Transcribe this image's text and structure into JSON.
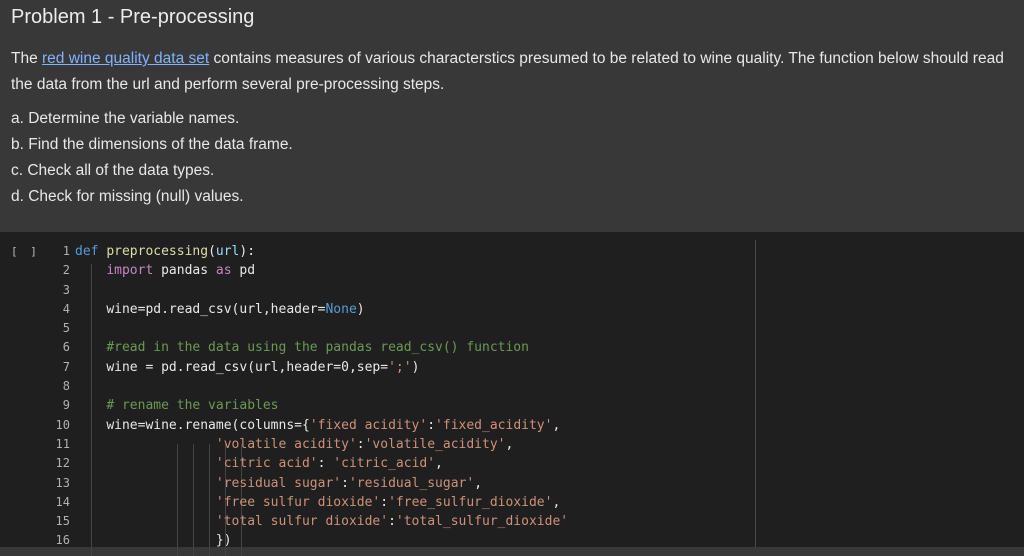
{
  "text_cell": {
    "title": "Problem 1 - Pre-processing",
    "intro_before_link": "The ",
    "link_text": "red wine quality data set",
    "intro_after_link": " contains measures of various characterstics presumed to be related to wine quality. The function below should read the data from the url and perform several pre-processing steps.",
    "steps": [
      "a. Determine the variable names.",
      "b. Find the dimensions of the data frame.",
      "c. Check all of the data types.",
      "d. Check for missing (null) values."
    ]
  },
  "code_cell": {
    "run_label": "[ ]",
    "line_numbers": [
      "1",
      "2",
      "3",
      "4",
      "5",
      "6",
      "7",
      "8",
      "9",
      "10",
      "11",
      "12",
      "13",
      "14",
      "15",
      "16"
    ],
    "lines": {
      "l1_kw": "def",
      "l1_fn": "preprocessing",
      "l1_p1": "(",
      "l1_arg": "url",
      "l1_p2": "):",
      "l2_import": "import",
      "l2_mod": " pandas ",
      "l2_as": "as",
      "l2_alias": " pd",
      "l4": "wine=pd.read_csv(url,header=",
      "l4_none": "None",
      "l4_end": ")",
      "l6": "#read in the data using the pandas read_csv() function",
      "l7_a": "wine = pd.read_csv(url,header=0,sep=",
      "l7_str": "';'",
      "l7_b": ")",
      "l9": "# rename the variables",
      "l10_a": "wine=wine.rename(columns={",
      "l10_k": "'fixed acidity'",
      "l10_c": ":",
      "l10_v": "'fixed_acidity'",
      "l10_e": ",",
      "l11_k": "'volatile acidity'",
      "l11_c": ":",
      "l11_v": "'volatile_acidity'",
      "l11_e": ",",
      "l12_k": "'citric acid'",
      "l12_c": ": ",
      "l12_v": "'citric_acid'",
      "l12_e": ",",
      "l13_k": "'residual sugar'",
      "l13_c": ":",
      "l13_v": "'residual_sugar'",
      "l13_e": ",",
      "l14_k": "'free sulfur dioxide'",
      "l14_c": ":",
      "l14_v": "'free_sulfur_dioxide'",
      "l14_e": ",",
      "l15_k": "'total sulfur dioxide'",
      "l15_c": ":",
      "l15_v": "'total_sulfur_dioxide'",
      "l16": "})"
    }
  }
}
